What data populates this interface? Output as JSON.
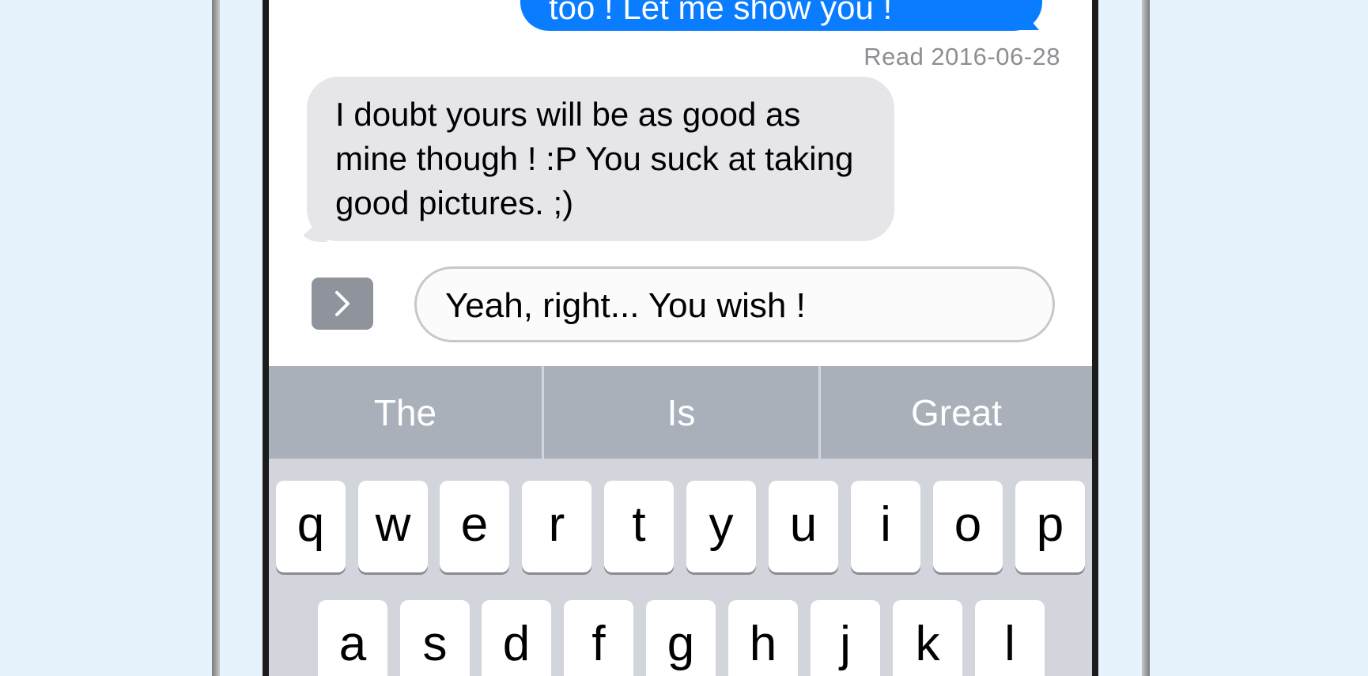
{
  "conversation": {
    "outgoing_message": "too ! Let me show you !",
    "read_receipt": "Read 2016-06-28",
    "incoming_message": "I doubt yours will be as good as mine though ! :P You suck at taking good pictures. ;)"
  },
  "composer": {
    "expand_icon": "chevron-right-icon",
    "input_value": "Yeah, right... You wish !",
    "send_icon": "arrow-up-icon"
  },
  "predictive": {
    "suggestions": [
      "The",
      "Is",
      "Great"
    ]
  },
  "keyboard": {
    "row1": [
      "q",
      "w",
      "e",
      "r",
      "t",
      "y",
      "u",
      "i",
      "o",
      "p"
    ],
    "row2": [
      "a",
      "s",
      "d",
      "f",
      "g",
      "h",
      "j",
      "k",
      "l"
    ]
  },
  "colors": {
    "outgoing_bubble": "#0a7cff",
    "incoming_bubble": "#e5e5ea",
    "predictive_bar": "#a9b0ba",
    "keyboard_bg": "#d2d5db"
  }
}
